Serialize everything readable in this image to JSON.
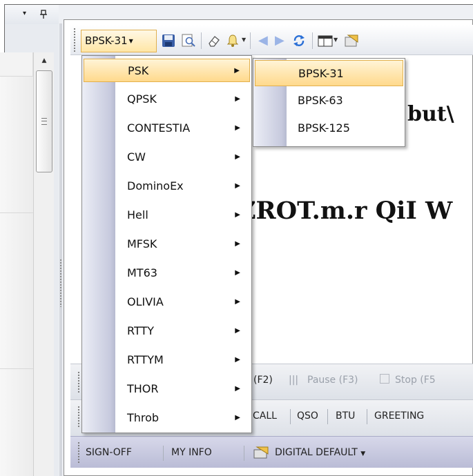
{
  "left_panel": {
    "menu_arrow": "▾",
    "pin_icon": "pin-icon",
    "scroll_up": "▲"
  },
  "toolbar": {
    "mode_select": "BPSK-31",
    "icons": [
      "save-icon",
      "print-preview-icon",
      "eraser-icon",
      "bell-icon",
      "back-arrow-icon",
      "forward-arrow-icon",
      "refresh-icon",
      "window-icon",
      "settings-icon"
    ]
  },
  "document": {
    "line1_partial": "but\\",
    "line2_partial": "ZROT.m.r QiI W"
  },
  "tx_bar": {
    "send_partial": "(F2)",
    "pause": "Pause (F3)",
    "stop": "Stop (F5"
  },
  "macro_bar": {
    "items": [
      "CALL",
      "QSO",
      "BTU",
      "GREETING"
    ]
  },
  "bottom_bar": {
    "items": [
      "SIGN-OFF",
      "MY INFO"
    ],
    "profile": "DIGITAL DEFAULT"
  },
  "mode_menu": {
    "items": [
      "PSK",
      "QPSK",
      "CONTESTIA",
      "CW",
      "DominoEx",
      "Hell",
      "MFSK",
      "MT63",
      "OLIVIA",
      "RTTY",
      "RTTYM",
      "THOR",
      "Throb"
    ],
    "highlighted": "PSK"
  },
  "psk_submenu": {
    "items": [
      "BPSK-31",
      "BPSK-63",
      "BPSK-125"
    ],
    "highlighted": "BPSK-31"
  },
  "colors": {
    "highlight_top": "#fff4d6",
    "highlight_bottom": "#ffd98c",
    "highlight_border": "#e2b04c",
    "bottom_bar": "#c6c8e0"
  }
}
